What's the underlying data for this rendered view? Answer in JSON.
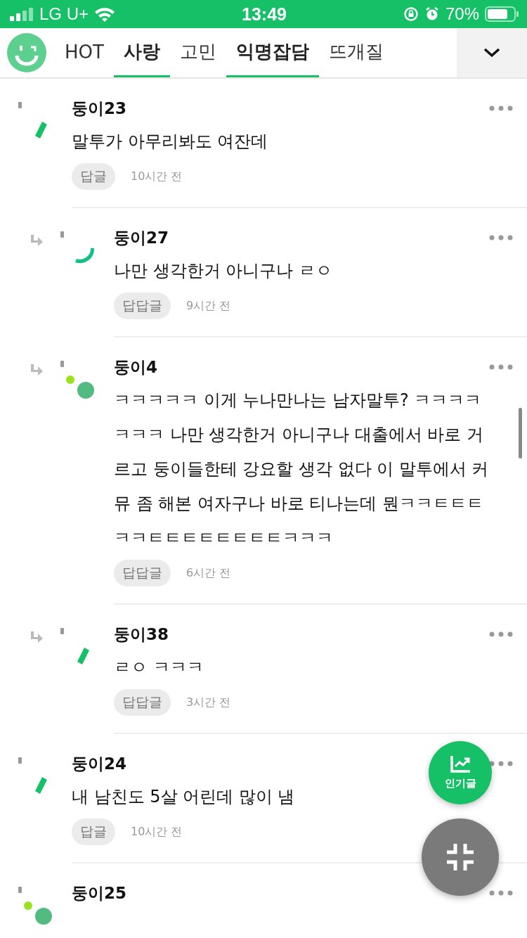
{
  "status_bar": {
    "carrier": "LG U+",
    "time": "13:49",
    "battery": "70%"
  },
  "tabs": [
    {
      "label": "HOT",
      "selected": false
    },
    {
      "label": "사랑",
      "selected": true
    },
    {
      "label": "고민",
      "selected": false
    },
    {
      "label": "익명잡담",
      "selected": true
    },
    {
      "label": "뜨개질",
      "selected": false
    }
  ],
  "comments": [
    {
      "author": "둥이23",
      "text": "말투가 아무리봐도 여잔데",
      "reply_button": "답글",
      "time": "10시간 전",
      "reply": false,
      "avatar": {
        "kind": "dash"
      }
    },
    {
      "author": "둥이27",
      "text": "나만 생각한거 아니구나 ㄹㅇ",
      "reply_button": "답답글",
      "time": "9시간 전",
      "reply": true,
      "avatar": {
        "kind": "arc"
      }
    },
    {
      "author": "둥이4",
      "text": "ㅋㅋㅋㅋㅋ 이게 누나만나는 남자말투? ㅋㅋㅋㅋㅋㅋㅋ 나만 생각한거 아니구나 대출에서 바로 거르고 둥이들한테 강요할 생각 없다 이 말투에서 커뮤 좀 해본 여자구나 바로 티나는데 뭔ㅋㅋㅌㅌㅌㅋㅋㅌㅌㅌㅌㅌㅌㅌㅌㅋㅋㅋ",
      "reply_button": "답답글",
      "time": "6시간 전",
      "reply": true,
      "avatar": {
        "kind": "dots"
      }
    },
    {
      "author": "둥이38",
      "text": "ㄹㅇ ㅋㅋㅋ",
      "reply_button": "답답글",
      "time": "3시간 전",
      "reply": true,
      "avatar": {
        "kind": "dash"
      }
    },
    {
      "author": "둥이24",
      "text": "내 남친도 5살 어린데 많이 냄",
      "reply_button": "답글",
      "time": "10시간 전",
      "reply": false,
      "avatar": {
        "kind": "dash"
      }
    },
    {
      "author": "둥이25",
      "reply": false,
      "avatar": {
        "kind": "dots"
      }
    }
  ],
  "fab": {
    "label": "인기글"
  }
}
